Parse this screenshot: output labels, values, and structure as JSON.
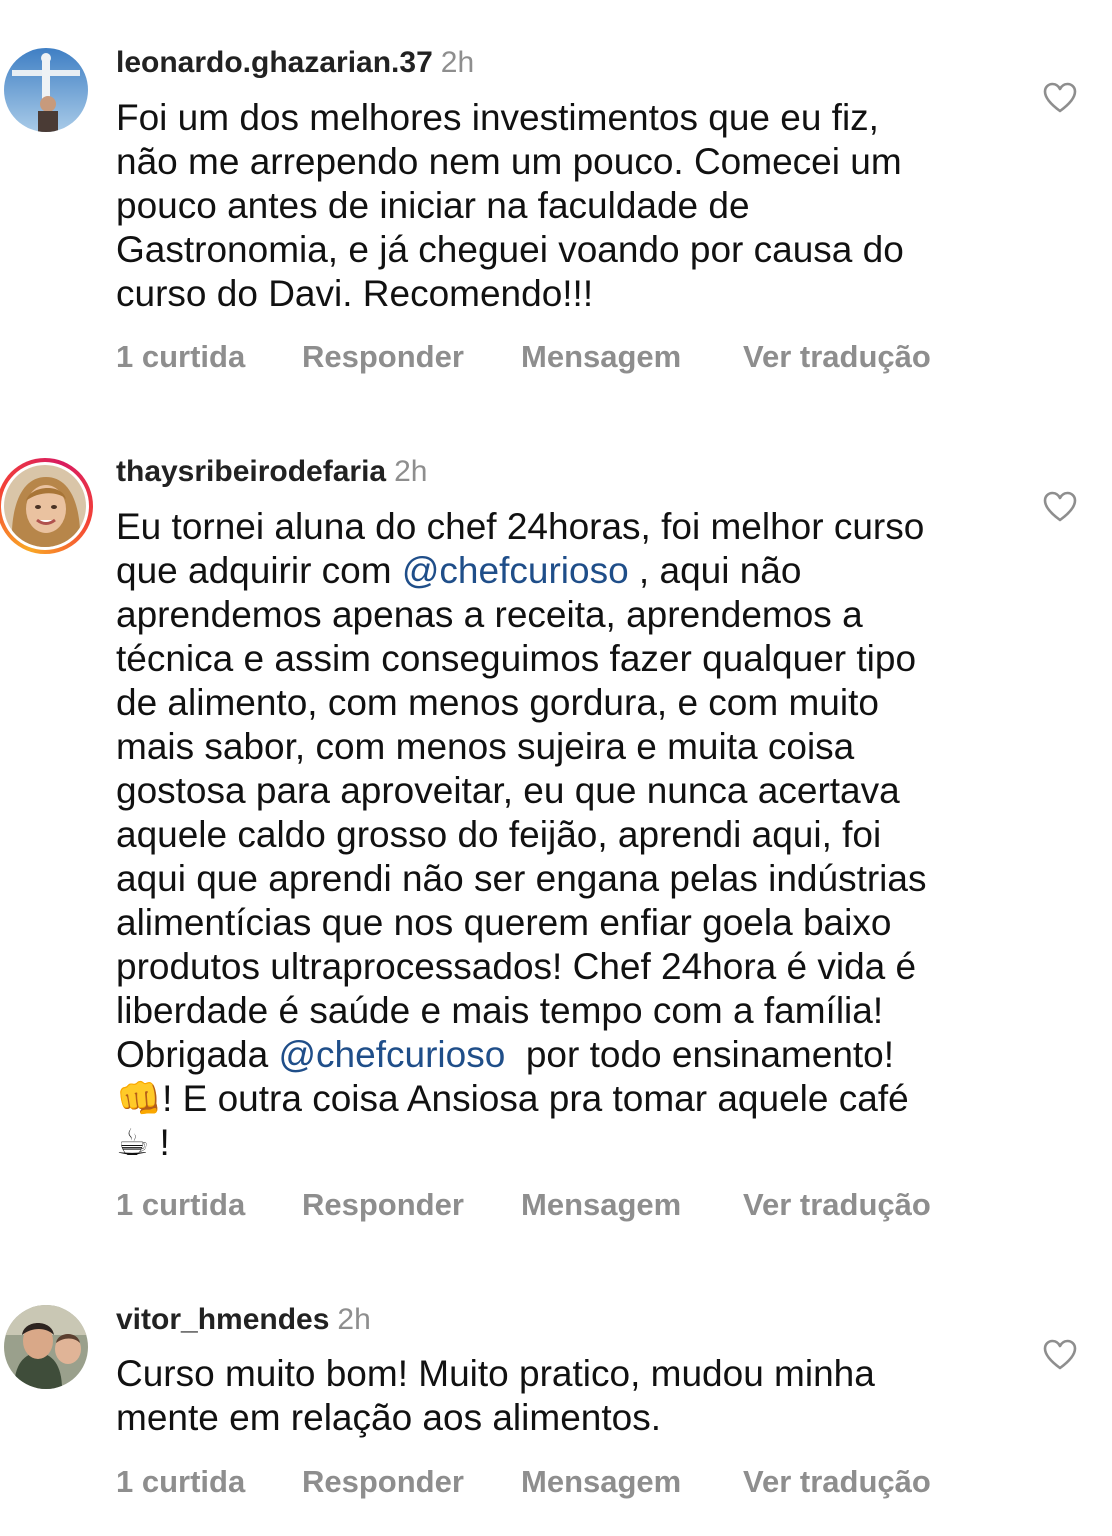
{
  "comments": [
    {
      "username": "leonardo.ghazarian.37",
      "time": "2h",
      "lines": [
        "Foi um dos melhores investimentos que eu fiz,",
        "não me arrependo nem um pouco. Comecei um",
        "pouco antes de iniciar na faculdade de",
        "Gastronomia, e já cheguei voando por causa do",
        "curso do Davi. Recomendo!!!"
      ],
      "likes": "1 curtida",
      "reply": "Responder",
      "message": "Mensagem",
      "translate": "Ver tradução"
    },
    {
      "username": "thaysribeirodefaria",
      "time": "2h",
      "line1": "Eu tornei aluna do chef 24horas, foi melhor curso",
      "line2_pre": "que adquirir com ",
      "mention": "@chefcurioso",
      "line2_post": " , aqui não",
      "lines_mid": [
        "aprendemos apenas a receita, aprendemos a",
        "técnica e assim conseguimos fazer qualquer tipo",
        "de alimento, com menos gordura, e com muito",
        "mais sabor, com menos sujeira e muita coisa",
        "gostosa para aproveitar, eu que nunca acertava",
        "aquele caldo grosso do feijão, aprendi aqui, foi",
        "aqui que aprendi não ser engana pelas indústrias",
        "alimentícias que nos querem enfiar goela baixo",
        "produtos ultraprocessados! Chef 24hora é vida é",
        "liberdade é saúde e mais tempo com a família!"
      ],
      "line13_pre": "Obrigada ",
      "line13_post": "  por todo ensinamento!",
      "line14_emoji": "👊",
      "line14_text": "! E outra coisa Ansiosa pra tomar aquele café",
      "line15_emoji": "☕",
      "line15_text": " !",
      "likes": "1 curtida",
      "reply": "Responder",
      "message": "Mensagem",
      "translate": "Ver tradução"
    },
    {
      "username": "vitor_hmendes",
      "time": "2h",
      "lines": [
        "Curso muito bom! Muito pratico, mudou minha",
        "mente em relação aos alimentos."
      ],
      "likes": "1 curtida",
      "reply": "Responder",
      "message": "Mensagem",
      "translate": "Ver tradução"
    }
  ],
  "colors": {
    "text": "#111111",
    "muted": "#8e8e8e",
    "mention": "#1f4e89",
    "story_ring_start": "#f9a825",
    "story_ring_end": "#d81b60"
  },
  "icons": {
    "like": "heart-outline-icon"
  }
}
